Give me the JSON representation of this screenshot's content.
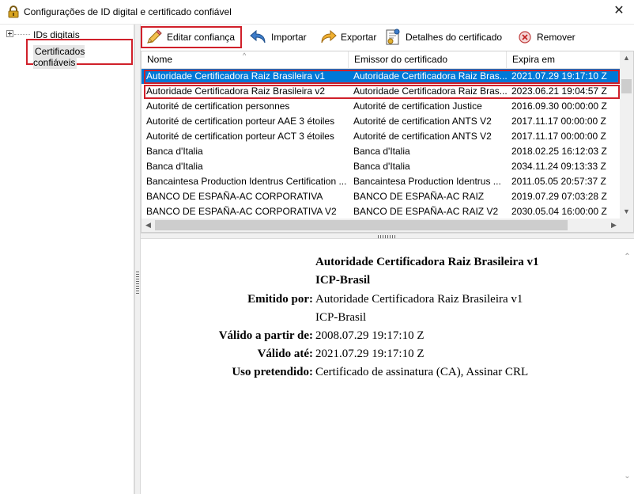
{
  "window": {
    "title": "Configurações de ID digital e certificado confiável",
    "close_label": "✕"
  },
  "sidebar": {
    "items": [
      {
        "label": "IDs digitais",
        "expander": "⊞"
      },
      {
        "label": "Certificados confiáveis"
      }
    ]
  },
  "toolbar": {
    "edit_label": "Editar confiança",
    "import_label": "Importar",
    "export_label": "Exportar",
    "details_label": "Detalhes do certificado",
    "remove_label": "Remover"
  },
  "table": {
    "columns": [
      "Nome",
      "Emissor do certificado",
      "Expira em"
    ],
    "sort_indicator": "^",
    "rows": [
      {
        "name": "Autoridade Certificadora Raiz Brasileira v1",
        "issuer": "Autoridade Certificadora Raiz Bras...",
        "expires": "2021.07.29 19:17:10 Z"
      },
      {
        "name": "Autoridade Certificadora Raiz Brasileira v2",
        "issuer": "Autoridade Certificadora Raiz Bras...",
        "expires": "2023.06.21 19:04:57 Z"
      },
      {
        "name": "Autorité de certification personnes",
        "issuer": "Autorité de certification Justice",
        "expires": "2016.09.30 00:00:00 Z"
      },
      {
        "name": "Autorité de certification porteur AAE 3 étoiles",
        "issuer": "Autorité de certification ANTS V2",
        "expires": "2017.11.17 00:00:00 Z"
      },
      {
        "name": "Autorité de certification porteur ACT 3 étoiles",
        "issuer": "Autorité de certification ANTS V2",
        "expires": "2017.11.17 00:00:00 Z"
      },
      {
        "name": "Banca d'Italia",
        "issuer": "Banca d'Italia",
        "expires": "2018.02.25 16:12:03 Z"
      },
      {
        "name": "Banca d'Italia",
        "issuer": "Banca d'Italia",
        "expires": "2034.11.24 09:13:33 Z"
      },
      {
        "name": "Bancaintesa Production Identrus Certification ...",
        "issuer": "Bancaintesa Production Identrus ...",
        "expires": "2011.05.05 20:57:37 Z"
      },
      {
        "name": "BANCO DE ESPAÑA-AC CORPORATIVA",
        "issuer": "BANCO DE ESPAÑA-AC RAIZ",
        "expires": "2019.07.29 07:03:28 Z"
      },
      {
        "name": "BANCO DE ESPAÑA-AC CORPORATIVA V2",
        "issuer": "BANCO DE ESPAÑA-AC RAIZ V2",
        "expires": "2030.05.04 16:00:00 Z"
      }
    ],
    "selected_index": 0
  },
  "details": {
    "name_line1": "Autoridade Certificadora Raiz Brasileira v1",
    "name_line2": "ICP-Brasil",
    "issued_by_label": "Emitido por:",
    "issued_by_line1": "Autoridade Certificadora Raiz Brasileira v1",
    "issued_by_line2": "ICP-Brasil",
    "valid_from_label": "Válido a partir de:",
    "valid_from": "2008.07.29 19:17:10 Z",
    "valid_until_label": "Válido até:",
    "valid_until": "2021.07.29 19:17:10 Z",
    "usage_label": "Uso pretendido:",
    "usage": "Certificado de assinatura (CA), Assinar CRL"
  },
  "colors": {
    "selection": "#0078d7",
    "highlight_outline": "#d0202a"
  }
}
